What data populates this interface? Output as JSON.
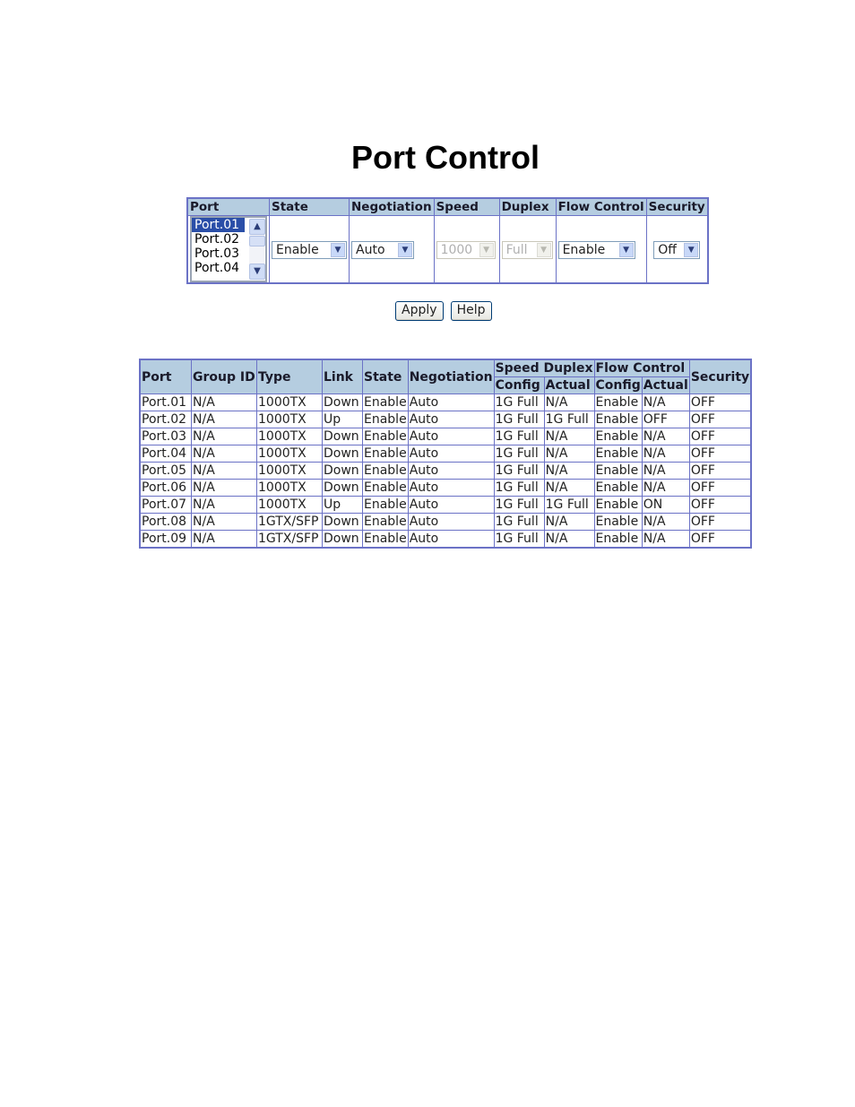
{
  "page": {
    "title": "Port Control"
  },
  "config_form": {
    "headers": [
      "Port",
      "State",
      "Negotiation",
      "Speed",
      "Duplex",
      "Flow Control",
      "Security"
    ],
    "port_list": {
      "options": [
        "Port.01",
        "Port.02",
        "Port.03",
        "Port.04"
      ],
      "selected": "Port.01"
    },
    "state": {
      "value": "Enable",
      "disabled": false
    },
    "negotiation": {
      "value": "Auto",
      "disabled": false
    },
    "speed": {
      "value": "1000",
      "disabled": true
    },
    "duplex": {
      "value": "Full",
      "disabled": true
    },
    "flow_control": {
      "value": "Enable",
      "disabled": false
    },
    "security": {
      "value": "Off",
      "disabled": false
    }
  },
  "buttons": {
    "apply": "Apply",
    "help": "Help"
  },
  "status_table": {
    "headers": {
      "port": "Port",
      "group_id": "Group ID",
      "type": "Type",
      "link": "Link",
      "state": "State",
      "negotiation": "Negotiation",
      "speed_duplex": "Speed Duplex",
      "flow_control": "Flow Control",
      "security": "Security",
      "config": "Config",
      "actual": "Actual"
    },
    "rows": [
      [
        "Port.01",
        "N/A",
        "1000TX",
        "Down",
        "Enable",
        "Auto",
        "1G Full",
        "N/A",
        "Enable",
        "N/A",
        "OFF"
      ],
      [
        "Port.02",
        "N/A",
        "1000TX",
        "Up",
        "Enable",
        "Auto",
        "1G Full",
        "1G Full",
        "Enable",
        "OFF",
        "OFF"
      ],
      [
        "Port.03",
        "N/A",
        "1000TX",
        "Down",
        "Enable",
        "Auto",
        "1G Full",
        "N/A",
        "Enable",
        "N/A",
        "OFF"
      ],
      [
        "Port.04",
        "N/A",
        "1000TX",
        "Down",
        "Enable",
        "Auto",
        "1G Full",
        "N/A",
        "Enable",
        "N/A",
        "OFF"
      ],
      [
        "Port.05",
        "N/A",
        "1000TX",
        "Down",
        "Enable",
        "Auto",
        "1G Full",
        "N/A",
        "Enable",
        "N/A",
        "OFF"
      ],
      [
        "Port.06",
        "N/A",
        "1000TX",
        "Down",
        "Enable",
        "Auto",
        "1G Full",
        "N/A",
        "Enable",
        "N/A",
        "OFF"
      ],
      [
        "Port.07",
        "N/A",
        "1000TX",
        "Up",
        "Enable",
        "Auto",
        "1G Full",
        "1G Full",
        "Enable",
        "ON",
        "OFF"
      ],
      [
        "Port.08",
        "N/A",
        "1GTX/SFP",
        "Down",
        "Enable",
        "Auto",
        "1G Full",
        "N/A",
        "Enable",
        "N/A",
        "OFF"
      ],
      [
        "Port.09",
        "N/A",
        "1GTX/SFP",
        "Down",
        "Enable",
        "Auto",
        "1G Full",
        "N/A",
        "Enable",
        "N/A",
        "OFF"
      ]
    ]
  },
  "colors": {
    "header_bg": "#b5cde0",
    "border": "#6b72c6",
    "selection": "#2a4ea8"
  }
}
